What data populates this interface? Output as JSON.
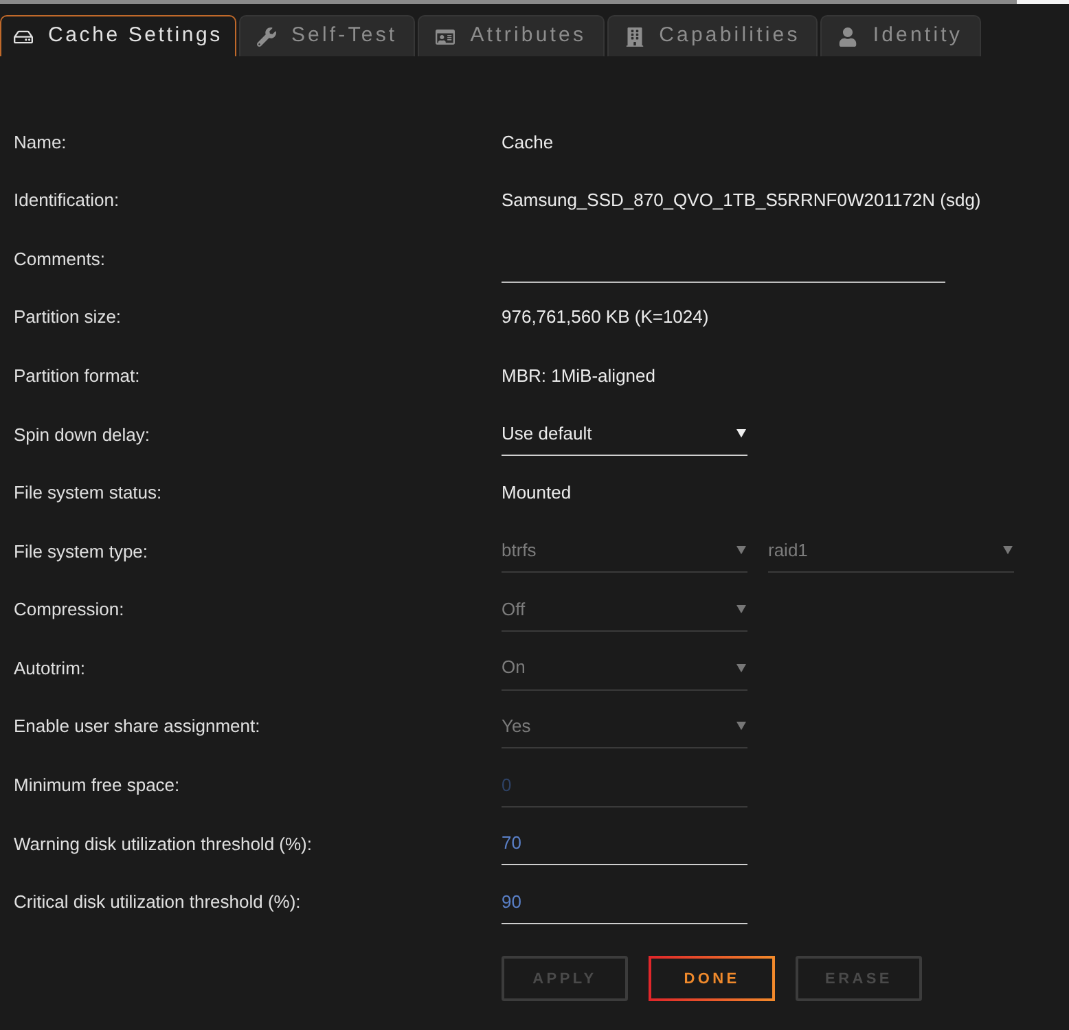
{
  "tabs": [
    {
      "label": "Cache Settings",
      "selected": true
    },
    {
      "label": "Self-Test",
      "selected": false
    },
    {
      "label": "Attributes",
      "selected": false
    },
    {
      "label": "Capabilities",
      "selected": false
    },
    {
      "label": "Identity",
      "selected": false
    }
  ],
  "settings": [
    {
      "kind": "text",
      "label": "Name:",
      "value": "Cache"
    },
    {
      "kind": "text",
      "label": "Identification:",
      "value": "Samsung_SSD_870_QVO_1TB_S5RRNF0W201172N (sdg)"
    },
    {
      "kind": "input",
      "label": "Comments:"
    },
    {
      "kind": "text",
      "label": "Partition size:",
      "value": "976,761,560 KB (K=1024)"
    },
    {
      "kind": "text",
      "label": "Partition format:",
      "value": "MBR: 1MiB-aligned"
    },
    {
      "kind": "select",
      "label": "Spin down delay:",
      "selects": [
        {
          "value": "Use default",
          "disabled": false
        }
      ]
    },
    {
      "kind": "text",
      "label": "File system status:",
      "value": "Mounted"
    },
    {
      "kind": "select",
      "label": "File system type:",
      "selects": [
        {
          "value": "btrfs",
          "disabled": true
        },
        {
          "value": "raid1",
          "disabled": true
        }
      ]
    },
    {
      "kind": "select",
      "label": "Compression:",
      "selects": [
        {
          "value": "Off",
          "disabled": true
        }
      ]
    },
    {
      "kind": "select",
      "label": "Autotrim:",
      "selects": [
        {
          "value": "On",
          "disabled": true
        }
      ]
    },
    {
      "kind": "select",
      "label": "Enable user share assignment:",
      "selects": [
        {
          "value": "Yes",
          "disabled": true
        }
      ]
    },
    {
      "kind": "number",
      "label": "Minimum free space:",
      "value": "0",
      "disabled": true
    },
    {
      "kind": "number",
      "label": "Warning disk utilization threshold (%):",
      "value": "70",
      "disabled": false
    },
    {
      "kind": "number",
      "label": "Critical disk utilization threshold (%):",
      "value": "90",
      "disabled": false
    }
  ],
  "buttons": [
    {
      "label": "APPLY",
      "disabled": true
    },
    {
      "label": "DONE",
      "disabled": false
    },
    {
      "label": "ERASE",
      "disabled": true
    }
  ]
}
